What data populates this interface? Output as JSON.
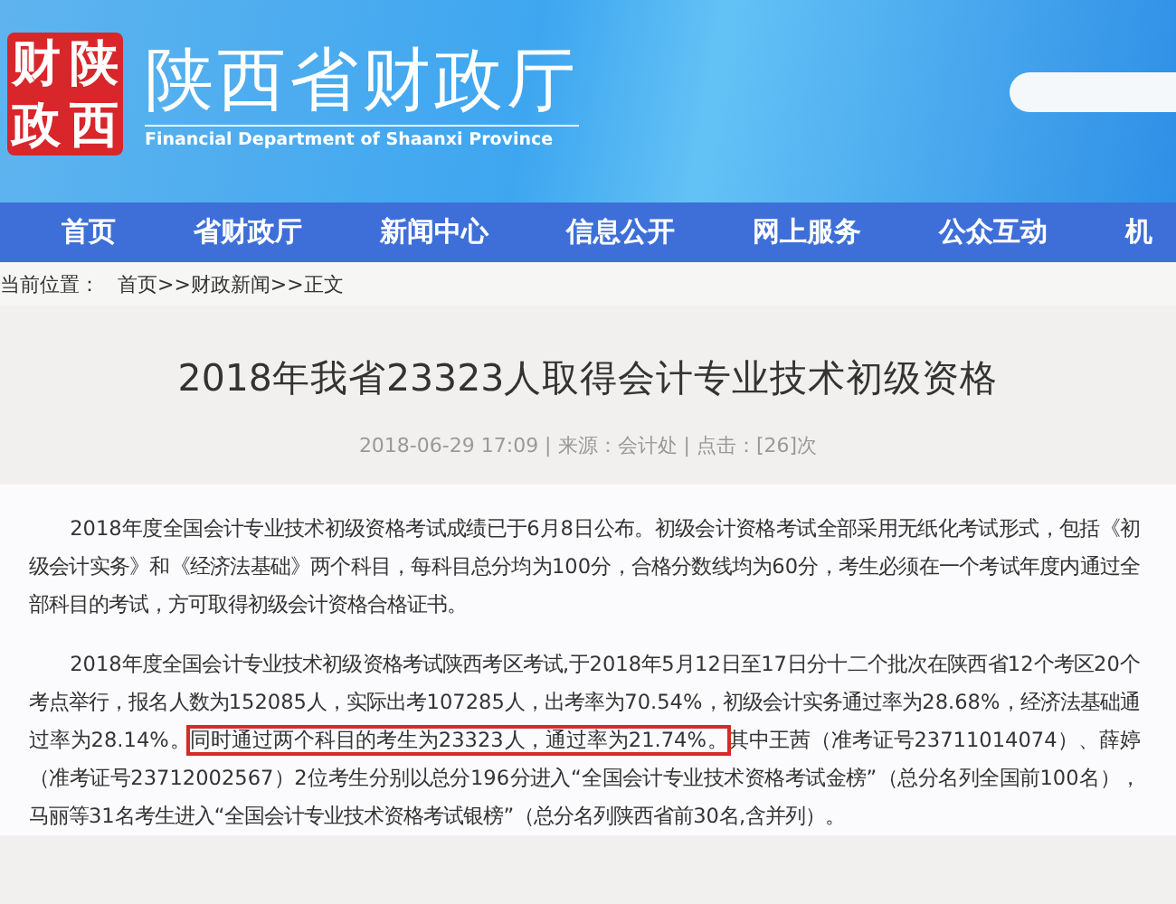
{
  "header": {
    "logo_chars": [
      "财",
      "陕",
      "政",
      "西"
    ],
    "site_title": "陕西省财政厅",
    "site_subtitle": "Financial Department of Shaanxi Province"
  },
  "nav": [
    {
      "label": "首页",
      "selected": false
    },
    {
      "label": "省财政厅",
      "selected": false
    },
    {
      "label": "新闻中心",
      "selected": false
    },
    {
      "label": "信息公开",
      "selected": false
    },
    {
      "label": "网上服务",
      "selected": false
    },
    {
      "label": "公众互动",
      "selected": false
    },
    {
      "label": "机",
      "selected": false
    }
  ],
  "breadcrumb": {
    "label": "当前位置：",
    "path": "首页>>财政新闻>>正文"
  },
  "article": {
    "title": "2018年我省23323人取得会计专业技术初级资格",
    "meta": "2018-06-29 17:09 | 来源：会计处 | 点击：[26]次",
    "paragraphs": [
      [
        {
          "text": "2018年度全国会计专业技术初级资格考试成绩已于6月8日公布。初级会计资格考试全部采用无纸化考试形式，包括《初级会计实务》和《经济法基础》两个科目，每科目总分均为100分，合格分数线均为60分，考生必须在一个考试年度内通过全部科目的考试，方可取得初级会计资格合格证书。",
          "highlighted": false
        }
      ],
      [
        {
          "text": "2018年度全国会计专业技术初级资格考试陕西考区考试,于2018年5月12日至17日分十二个批次在陕西省12个考区20个考点举行，报名人数为152085人，实际出考107285人，出考率为70.54%，初级会计实务通过率为28.68%，经济法基础通过率为28.14%。",
          "highlighted": false
        },
        {
          "text": "同时通过两个科目的考生为23323人，通过率为21.74%。",
          "highlighted": true
        },
        {
          "text": "其中王茜（准考证号23711014074）、薛婷（准考证号23712002567）2位考生分别以总分196分进入“全国会计专业技术资格考试金榜”（总分名列全国前100名），马丽等31名考生进入“全国会计专业技术资格考试银榜”（总分名列陕西省前30名,含并列）。",
          "highlighted": false
        }
      ]
    ]
  }
}
